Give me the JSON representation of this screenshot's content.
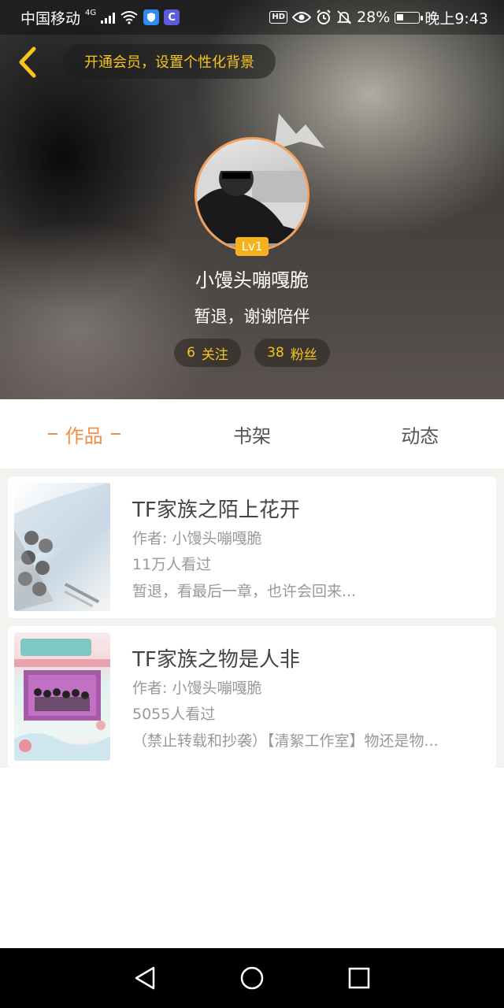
{
  "status_bar": {
    "carrier": "中国移动",
    "network": "4G",
    "battery_percent": "28%",
    "time": "晚上9:43",
    "hd_label": "HD",
    "app1_glyph": "C"
  },
  "header": {
    "vip_prompt": "开通会员，设置个性化背景",
    "level": "Lv1",
    "username": "小馒头嘣嘎脆",
    "signature": "暂退，谢谢陪伴",
    "follow_count": "6",
    "follow_label": "关注",
    "fans_count": "38",
    "fans_label": "粉丝"
  },
  "tabs": [
    {
      "label": "作品",
      "active": true
    },
    {
      "label": "书架",
      "active": false
    },
    {
      "label": "动态",
      "active": false
    }
  ],
  "works": [
    {
      "title": "TF家族之陌上花开",
      "author": "作者: 小馒头嘣嘎脆",
      "views": "11万人看过",
      "desc": "暂退，看最后一章，也许会回来..."
    },
    {
      "title": "TF家族之物是人非",
      "author": "作者: 小馒头嘣嘎脆",
      "views": "5055人看过",
      "desc": "（禁止转载和抄袭）【清絮工作室】物还是物..."
    }
  ],
  "colors": {
    "accent": "#f08f45",
    "gold": "#f6c61d",
    "level_badge": "#f6b21c",
    "avatar_ring": "#f2a05e"
  },
  "icons": {
    "back": "chevron-left-icon",
    "wifi": "wifi-icon",
    "eye": "eye-icon",
    "alarm": "alarm-icon",
    "mute": "bell-off-icon",
    "crown": "crown-icon",
    "nav_back": "triangle-back-icon",
    "nav_home": "circle-home-icon",
    "nav_recent": "square-recent-icon"
  }
}
